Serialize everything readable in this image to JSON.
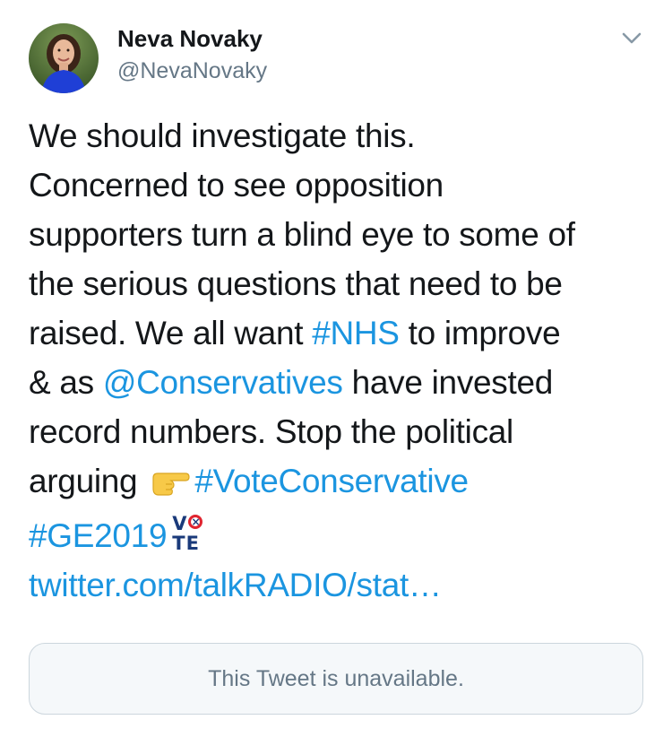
{
  "author": {
    "display_name": "Neva Novaky",
    "handle": "@NevaNovaky",
    "avatar_icon": "profile-photo"
  },
  "menu": {
    "icon": "chevron-down-icon"
  },
  "tweet": {
    "line1": "We should investigate this.",
    "line2": "Concerned to see opposition",
    "line3": "supporters turn a blind eye to some of",
    "line4": "the serious questions that need to be",
    "line5_pre": "raised. We all want ",
    "line5_hashtag": "#NHS",
    "line5_post": " to improve",
    "line6_pre": "& as ",
    "line6_mention": "@Conservatives",
    "line6_post": " have invested",
    "line7": "record numbers. Stop the political",
    "line8_pre": "arguing",
    "line8_emoji": "backhand-index-pointing-right",
    "line8_hashtag": "#VoteConservative",
    "line9_hashtag": "#GE2019",
    "vote_badge": {
      "top": "V",
      "bottom": "TE"
    },
    "link": "twitter.com/talkRADIO/stat…"
  },
  "quoted": {
    "text": "This Tweet is unavailable."
  },
  "colors": {
    "link": "#1b95e0",
    "text": "#14171a",
    "secondary": "#657786",
    "card_border": "#ccd6dd",
    "card_bg": "#f5f8fa"
  }
}
